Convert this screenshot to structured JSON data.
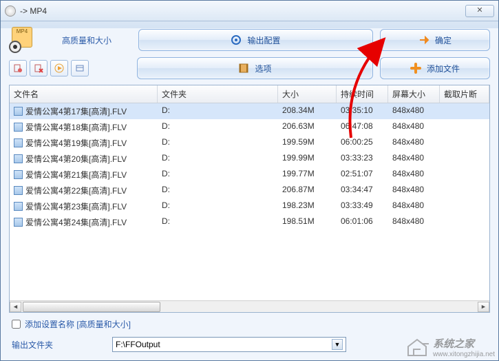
{
  "window": {
    "title": " -> MP4",
    "close_glyph": "✕"
  },
  "badge": {
    "text": "MP4"
  },
  "quality_label": "高质量和大小",
  "buttons": {
    "output_cfg": "输出配置",
    "ok": "确定",
    "options": "选项",
    "add_files": "添加文件"
  },
  "columns": {
    "name": "文件名",
    "folder": "文件夹",
    "size": "大小",
    "duration": "持续时间",
    "resolution": "屏幕大小",
    "clip": "截取片断"
  },
  "files": [
    {
      "name": "爱情公寓4第17集[高清].FLV",
      "folder": "D:",
      "size": "208.34M",
      "duration": "03:35:10",
      "res": "848x480"
    },
    {
      "name": "爱情公寓4第18集[高清].FLV",
      "folder": "D:",
      "size": "206.63M",
      "duration": "06:47:08",
      "res": "848x480"
    },
    {
      "name": "爱情公寓4第19集[高清].FLV",
      "folder": "D:",
      "size": "199.59M",
      "duration": "06:00:25",
      "res": "848x480"
    },
    {
      "name": "爱情公寓4第20集[高清].FLV",
      "folder": "D:",
      "size": "199.99M",
      "duration": "03:33:23",
      "res": "848x480"
    },
    {
      "name": "爱情公寓4第21集[高清].FLV",
      "folder": "D:",
      "size": "199.77M",
      "duration": "02:51:07",
      "res": "848x480"
    },
    {
      "name": "爱情公寓4第22集[高清].FLV",
      "folder": "D:",
      "size": "206.87M",
      "duration": "03:34:47",
      "res": "848x480"
    },
    {
      "name": "爱情公寓4第23集[高清].FLV",
      "folder": "D:",
      "size": "198.23M",
      "duration": "03:33:49",
      "res": "848x480"
    },
    {
      "name": "爱情公寓4第24集[高清].FLV",
      "folder": "D:",
      "size": "198.51M",
      "duration": "06:01:06",
      "res": "848x480"
    }
  ],
  "checkbox": {
    "label": "添加设置名称 [高质量和大小]",
    "checked": false
  },
  "output": {
    "label": "输出文件夹",
    "value": "F:\\FFOutput"
  },
  "watermark": {
    "name": "系统之家",
    "url": "www.xitongzhijia.net"
  },
  "annotation": {
    "color": "#e60000"
  }
}
